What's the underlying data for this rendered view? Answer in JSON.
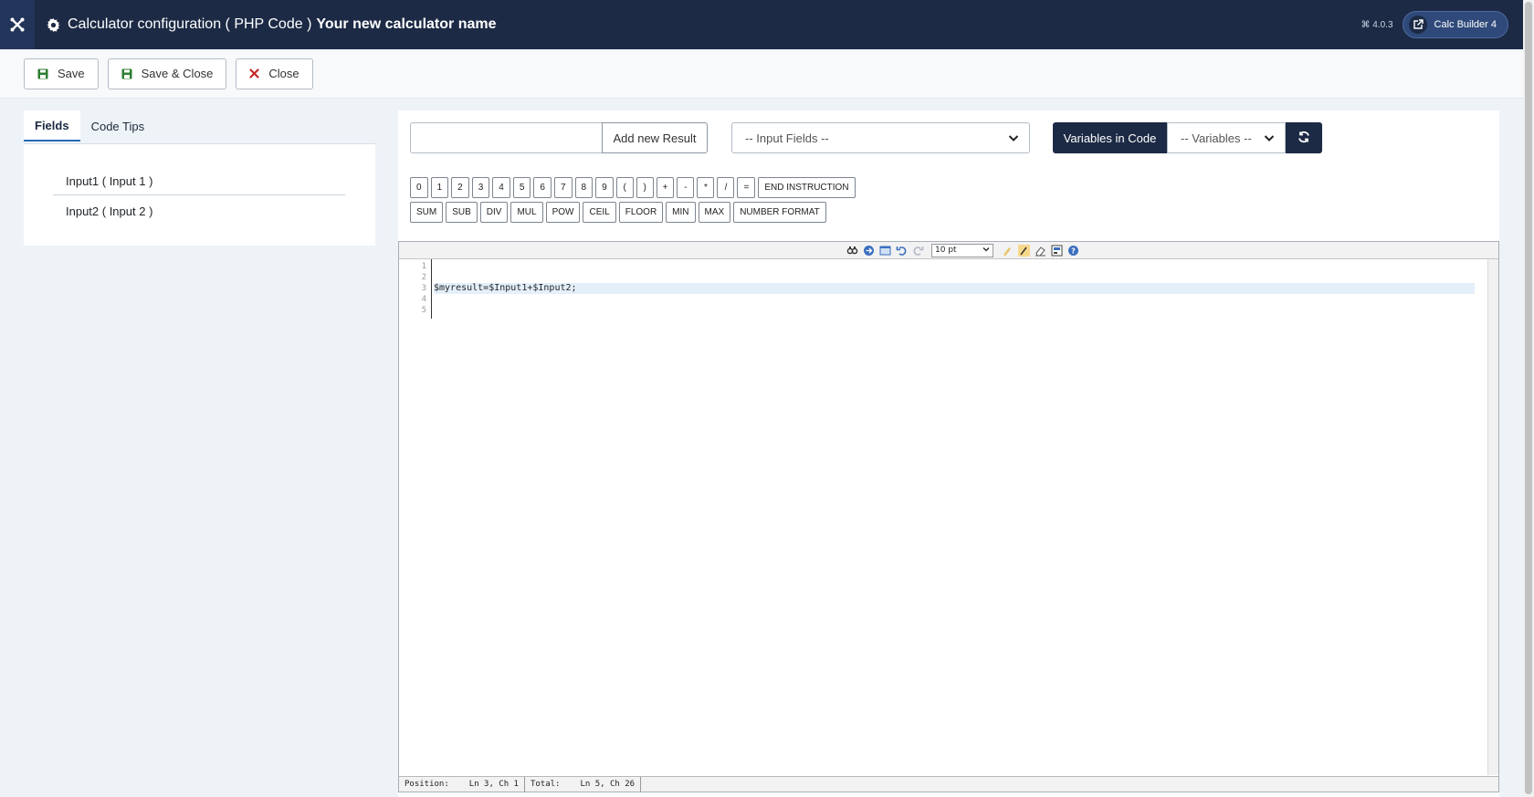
{
  "header": {
    "title_prefix": "Calculator configuration ( PHP Code )",
    "title_name": "Your new calculator name",
    "version": "⌘ 4.0.3",
    "app_button": "Calc Builder 4"
  },
  "toolbar": {
    "save": "Save",
    "save_close": "Save & Close",
    "close": "Close"
  },
  "left": {
    "tabs": [
      "Fields",
      "Code Tips"
    ],
    "fields": [
      "Input1 ( Input 1 )",
      "Input2 ( Input 2 )"
    ]
  },
  "right": {
    "result_input": {
      "value": "",
      "placeholder": ""
    },
    "add_result": "Add new Result",
    "input_fields_select": "-- Input Fields --",
    "variables_label": "Variables in Code",
    "variables_select": "-- Variables --",
    "buttons_row1": [
      "0",
      "1",
      "2",
      "3",
      "4",
      "5",
      "6",
      "7",
      "8",
      "9",
      "(",
      ")",
      "+",
      "-",
      "*",
      "/",
      "=",
      "END INSTRUCTION"
    ],
    "buttons_row2": [
      "SUM",
      "SUB",
      "DIV",
      "MUL",
      "POW",
      "CEIL",
      "FLOOR",
      "MIN",
      "MAX",
      "NUMBER FORMAT"
    ]
  },
  "editor": {
    "font_size": "10 pt",
    "line_numbers": [
      "1",
      "2",
      "3",
      "4",
      "5"
    ],
    "code_lines": [
      "",
      "",
      "$myresult=$Input1+$Input2;",
      "",
      ""
    ],
    "status": {
      "position_label": "Position:",
      "position_value": "Ln 3, Ch 1",
      "total_label": "Total:",
      "total_value": "Ln 5, Ch 26"
    }
  },
  "colors": {
    "header_bg": "#1c2a45",
    "dark_button": "#1c2a45",
    "page_bg": "#eef3f8",
    "save_icon": "#2e7d32",
    "close_icon": "#c62828"
  }
}
